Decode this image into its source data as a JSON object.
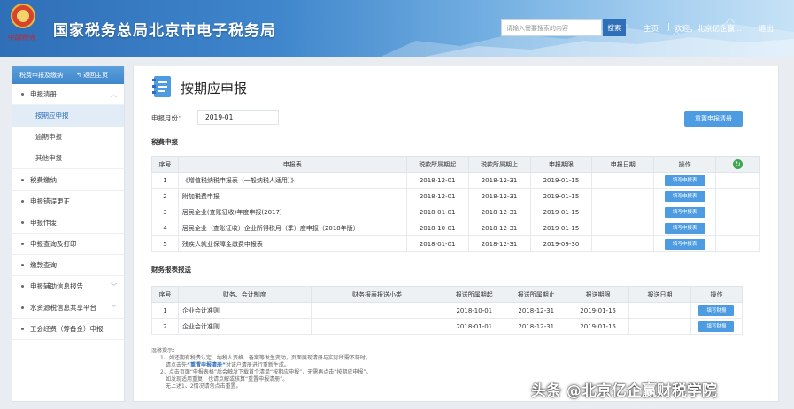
{
  "header": {
    "emblem_script": "中国税务",
    "title": "国家税务总局北京市电子税务局",
    "search_placeholder": "请输入需要搜索的内容",
    "search_button": "搜索",
    "home": "主页",
    "welcome": "欢迎，北京亿企赢...",
    "logout": "退出",
    "separator": "|"
  },
  "sidebar": {
    "header": "税费申报及缴纳",
    "back": "↰ 返回主页",
    "menus": [
      {
        "label": "申报清册",
        "expanded": true
      },
      {
        "label": "税费缴纳"
      },
      {
        "label": "申报错误更正"
      },
      {
        "label": "申报作废"
      },
      {
        "label": "申报查询及打印"
      },
      {
        "label": "缴款查询"
      },
      {
        "label": "申报辅助信息报告"
      },
      {
        "label": "水资源税信息共享平台"
      },
      {
        "label": "工会经费（筹备金）申报"
      }
    ],
    "submenu": [
      "按期应申报",
      "逾期申报",
      "其他申报"
    ]
  },
  "main": {
    "title": "按期应申报",
    "period_label": "申报月份：",
    "period_value": "2019-01",
    "reset_button": "重置申报清册",
    "section1": "税费申报",
    "section2": "财务报表报送",
    "tax_table": {
      "headers": [
        "序号",
        "申报表",
        "税款所属期起",
        "税款所属期止",
        "申报期限",
        "申报日期",
        "操作"
      ],
      "rows": [
        [
          "1",
          "《增值税纳税申报表（一般纳税人适用）》",
          "2018-12-01",
          "2018-12-31",
          "2019-01-15",
          "",
          "填写申报表"
        ],
        [
          "2",
          "附加税费申报",
          "2018-12-01",
          "2018-12-31",
          "2019-01-15",
          "",
          "填写申报表"
        ],
        [
          "3",
          "居民企业(查账征收)年度申报(2017)",
          "2018-01-01",
          "2018-12-31",
          "2019-01-15",
          "",
          "填写申报表"
        ],
        [
          "4",
          "居民企业（查账征收）企业所得税月（季）度申报（2018年版）",
          "2018-10-01",
          "2018-12-31",
          "2019-01-15",
          "",
          "填写申报表"
        ],
        [
          "5",
          "残疾人就业保障金缴费申报表",
          "2018-01-01",
          "2018-12-31",
          "2019-09-30",
          "",
          "填写申报表"
        ]
      ]
    },
    "fin_table": {
      "headers": [
        "序号",
        "财务、会计制度",
        "财务报表报送小类",
        "报送所属期起",
        "报送所属期止",
        "报送期限",
        "报送日期",
        "操作"
      ],
      "rows": [
        [
          "1",
          "企业会计准则",
          "",
          "2018-10-01",
          "2018-12-31",
          "2019-01-15",
          "",
          "填写财报"
        ],
        [
          "2",
          "企业会计准则",
          "",
          "2018-01-01",
          "2018-12-31",
          "2019-01-15",
          "",
          "填写财报"
        ]
      ]
    },
    "notes": {
      "title": "温馨提示：",
      "line1": "1、如还期有税费认定、纳税人资格、备案等发生变动，页面展现清册与实际所需不符时，",
      "line2a": "请点击先",
      "line2_highlight": "“重置申报清册”",
      "line2b": "对该户清册进行重新生成。",
      "line3": "2、点击页面“申报表格”后会触发下载首个清单“按期应申报”，无需再点击“按期应申报”。",
      "line4": "如发现适用重复，也请点解或核算“重置申报清册”。",
      "line5": "无上述1、2情况请勿点击重置。"
    }
  },
  "watermark": "头条 @北京亿企赢财税学院",
  "colors": {
    "accent": "#4d9be0",
    "header": "#2f6fb8",
    "refresh": "#3ea552"
  }
}
